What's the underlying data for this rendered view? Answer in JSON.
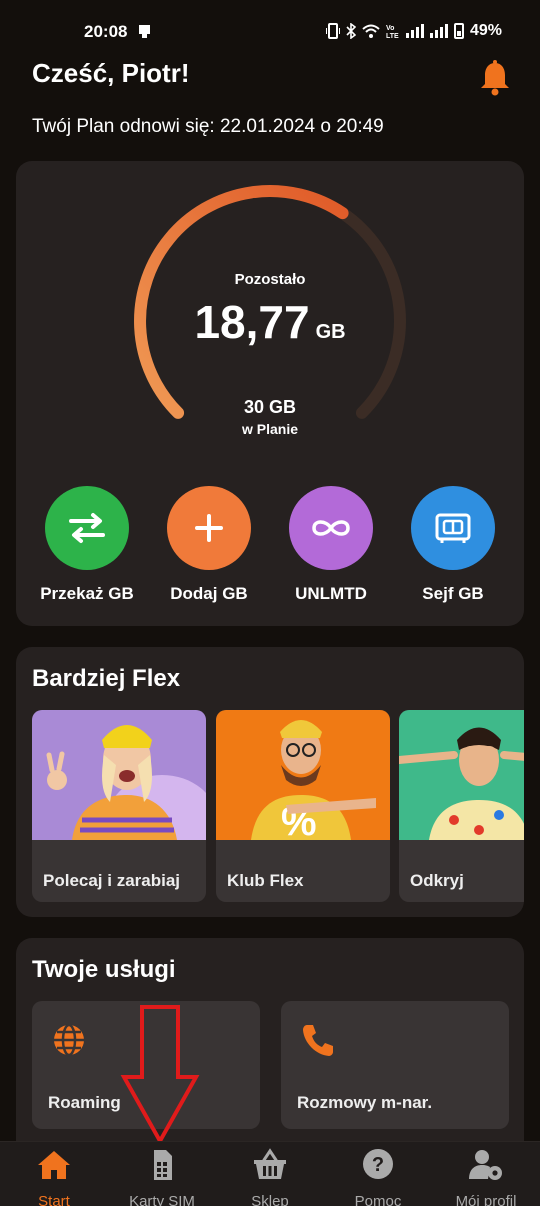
{
  "status_bar": {
    "time": "20:08",
    "battery": "49%"
  },
  "header": {
    "greeting": "Cześć, Piotr!",
    "renewal_text": "Twój Plan odnowi się: 22.01.2024 o 20:49"
  },
  "plan": {
    "remaining_label": "Pozostało",
    "remaining_value": "18,77",
    "remaining_unit": "GB",
    "total_value": "30 GB",
    "total_caption": "w Planie",
    "remaining_fraction": 0.6257
  },
  "actions": [
    {
      "label": "Przekaż GB",
      "icon": "transfer-arrows-icon",
      "color": "#2db34a"
    },
    {
      "label": "Dodaj GB",
      "icon": "plus-icon",
      "color": "#f07a3a"
    },
    {
      "label": "UNLMTD",
      "icon": "infinity-icon",
      "color": "#b36ad8"
    },
    {
      "label": "Sejf GB",
      "icon": "safe-icon",
      "color": "#2f8fe0"
    }
  ],
  "flex": {
    "title": "Bardziej Flex",
    "items": [
      {
        "title": "Polecaj i zarabiaj"
      },
      {
        "title": "Klub Flex"
      },
      {
        "title": "Odkryj"
      }
    ]
  },
  "services": {
    "title": "Twoje usługi",
    "items": [
      {
        "title": "Roaming",
        "icon": "globe-icon"
      },
      {
        "title": "Rozmowy m-nar.",
        "icon": "phone-icon"
      }
    ]
  },
  "nav": [
    {
      "label": "Start",
      "icon": "home-icon",
      "active": true
    },
    {
      "label": "Karty SIM",
      "icon": "sim-card-icon",
      "active": false
    },
    {
      "label": "Sklep",
      "icon": "basket-icon",
      "active": false
    },
    {
      "label": "Pomoc",
      "icon": "help-icon",
      "active": false
    },
    {
      "label": "Mój profil",
      "icon": "profile-settings-icon",
      "active": false
    }
  ],
  "colors": {
    "accent": "#f0731e",
    "background": "#130f0c",
    "card": "#262120",
    "tile": "#393434",
    "annotation_arrow": "#e01b1b"
  }
}
